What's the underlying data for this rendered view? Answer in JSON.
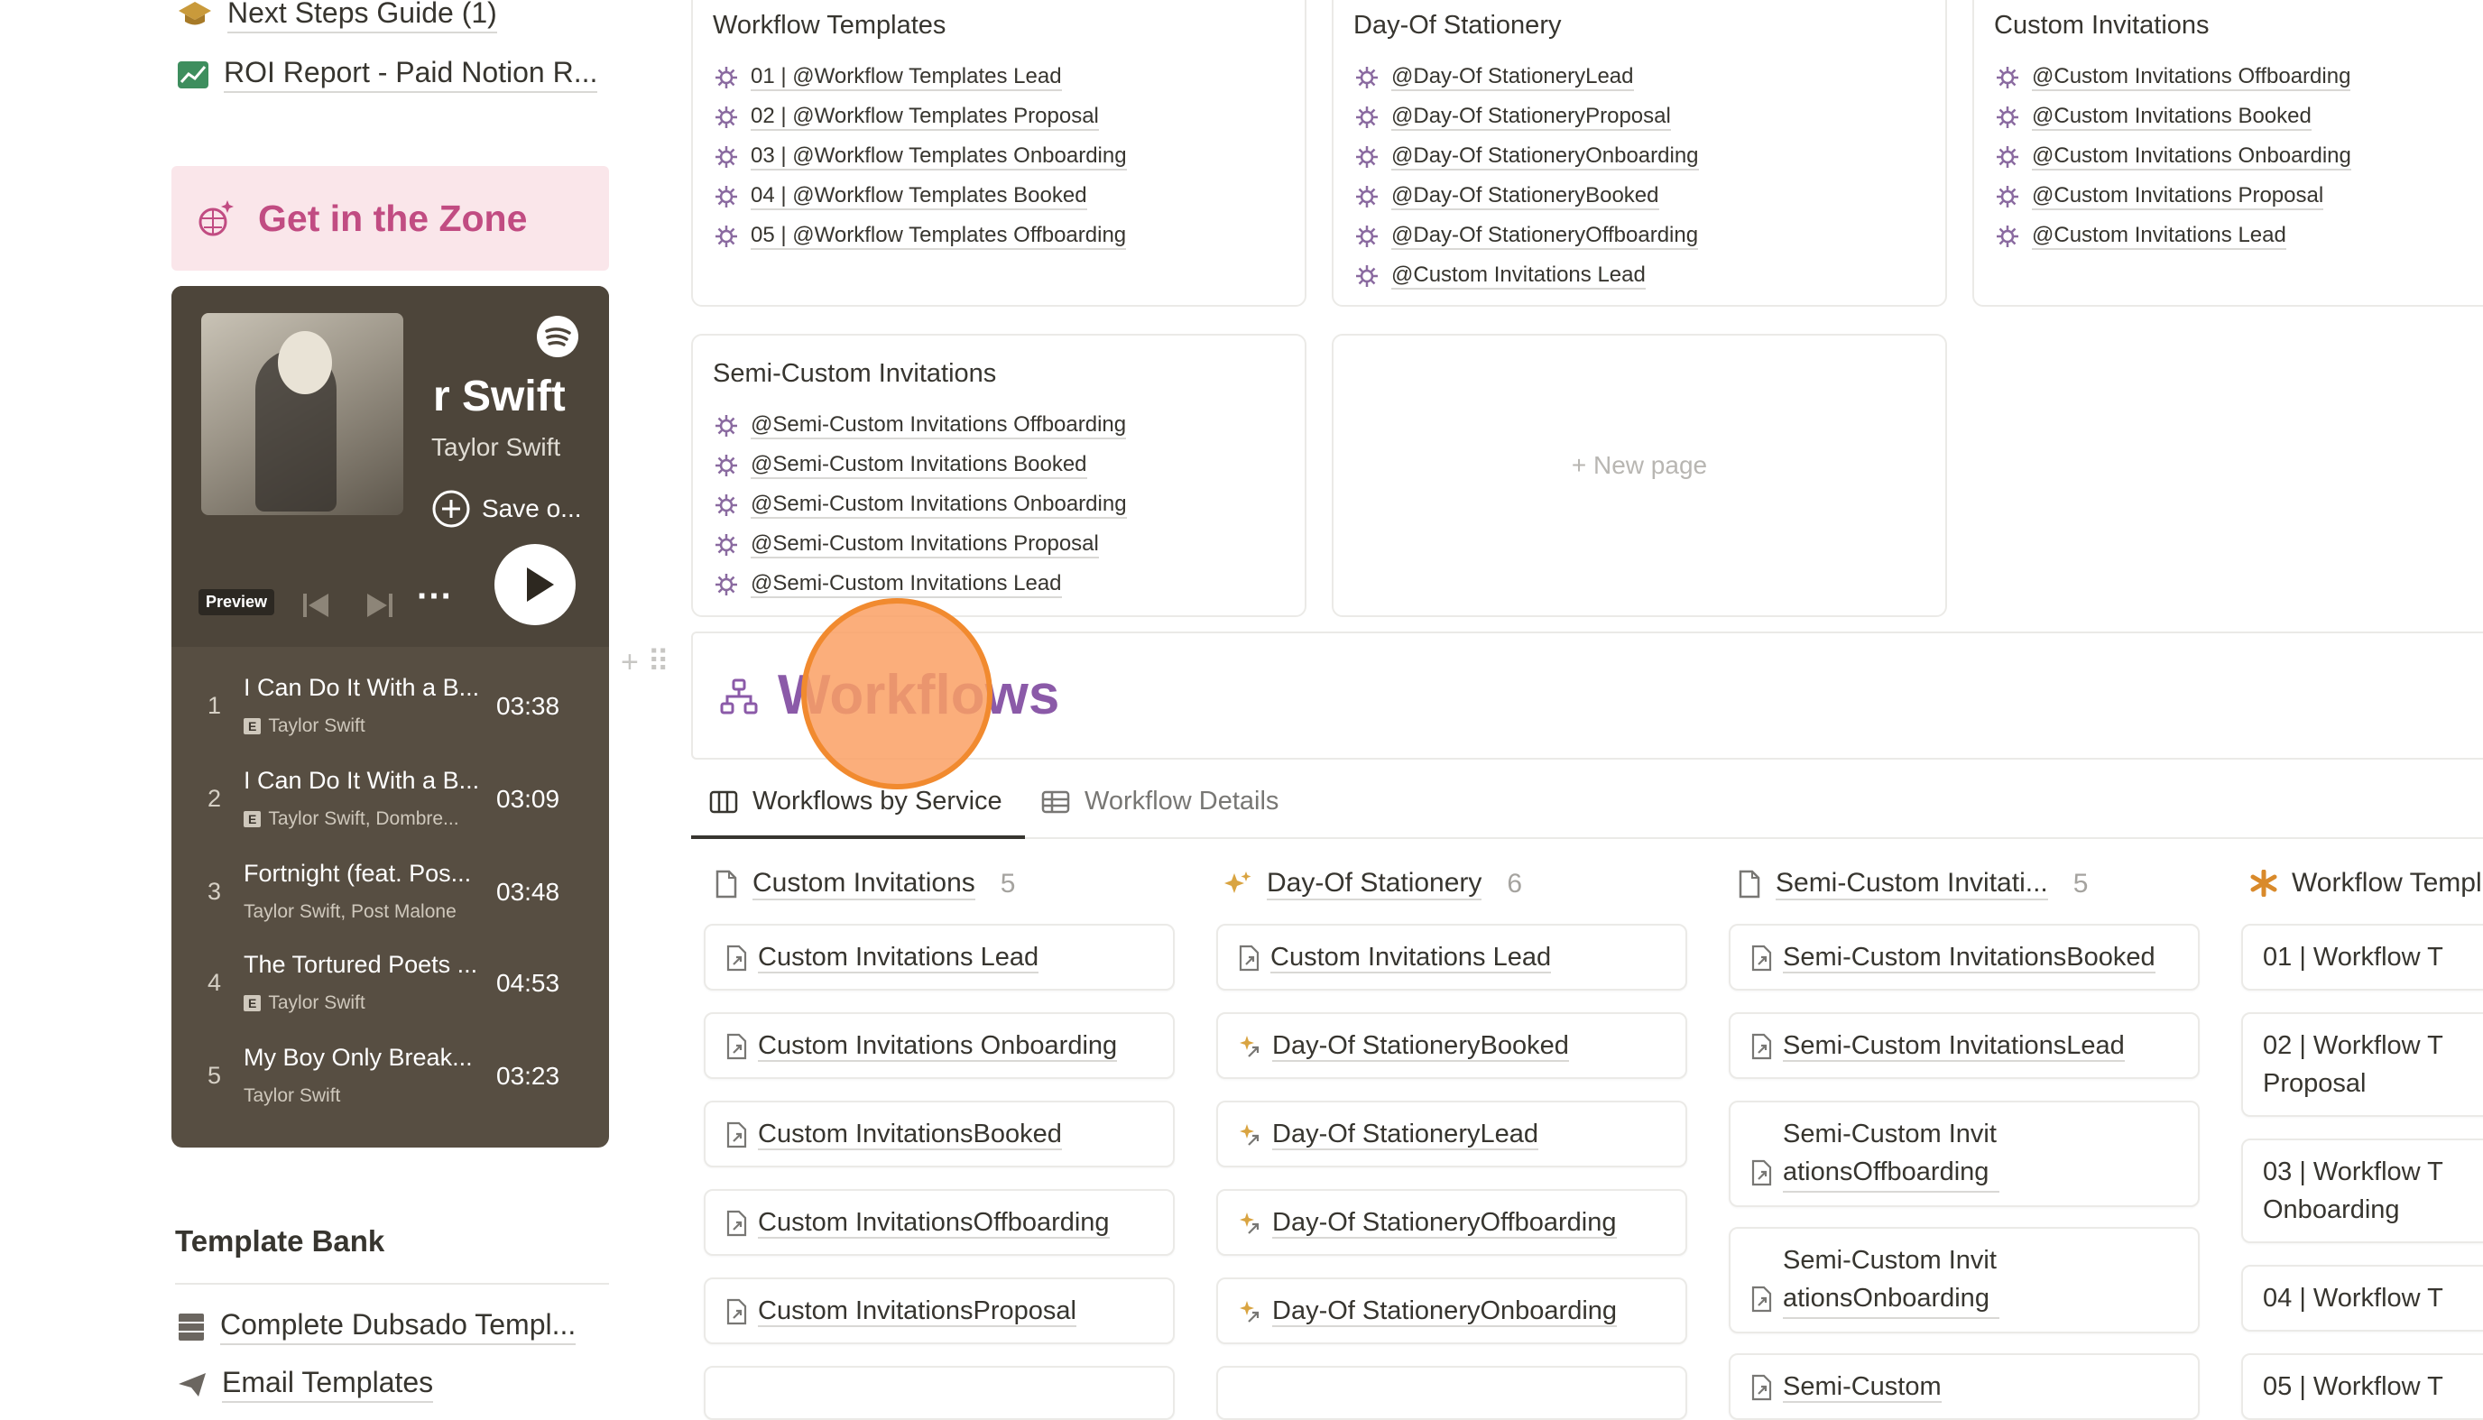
{
  "sidebar": {
    "links": [
      {
        "label": "Next Steps Guide (1)",
        "icon": "graduation-cap-icon"
      },
      {
        "label": "ROI Report - Paid Notion R...",
        "icon": "chart-icon"
      }
    ],
    "zone_title": "Get in the Zone",
    "template_bank": {
      "title": "Template Bank",
      "items": [
        {
          "label": "Complete Dubsado Templ...",
          "icon": "cabinet-icon"
        },
        {
          "label": "Email Templates",
          "icon": "paper-plane-icon"
        }
      ]
    }
  },
  "player": {
    "title": "r Swift",
    "artist": "Taylor Swift",
    "save_label": "Save o...",
    "preview_label": "Preview",
    "more": "···",
    "tracks": [
      {
        "num": "1",
        "name": "I Can Do It With a B...",
        "artist": "Taylor Swift",
        "explicit": "E",
        "duration": "03:38"
      },
      {
        "num": "2",
        "name": "I Can Do It With a B...",
        "artist": "Taylor Swift, Dombre...",
        "explicit": "E",
        "duration": "03:09"
      },
      {
        "num": "3",
        "name": "Fortnight (feat. Pos...",
        "artist": "Taylor Swift, Post Malone",
        "explicit": "",
        "duration": "03:48"
      },
      {
        "num": "4",
        "name": "The Tortured Poets ...",
        "artist": "Taylor Swift",
        "explicit": "E",
        "duration": "04:53"
      },
      {
        "num": "5",
        "name": "My Boy Only Break...",
        "artist": "Taylor Swift",
        "explicit": "",
        "duration": "03:23"
      }
    ]
  },
  "gallery": {
    "cards": [
      {
        "title": "Workflow Templates",
        "items": [
          "01 | @Workflow Templates Lead",
          "02 | @Workflow Templates Proposal",
          "03 | @Workflow Templates Onboarding",
          "04 | @Workflow Templates Booked",
          "05 | @Workflow Templates Offboarding"
        ]
      },
      {
        "title": "Day-Of Stationery",
        "items": [
          "@Day-Of StationeryLead",
          "@Day-Of StationeryProposal",
          "@Day-Of StationeryOnboarding",
          "@Day-Of StationeryBooked",
          "@Day-Of StationeryOffboarding",
          "@Custom Invitations Lead"
        ]
      },
      {
        "title": "Custom Invitations",
        "items": [
          "@Custom Invitations Offboarding",
          "@Custom Invitations Booked",
          "@Custom Invitations Onboarding",
          "@Custom Invitations Proposal",
          "@Custom Invitations Lead"
        ]
      },
      {
        "title": "Semi-Custom Invitations",
        "items": [
          "@Semi-Custom Invitations Offboarding",
          "@Semi-Custom Invitations Booked",
          "@Semi-Custom Invitations Onboarding",
          "@Semi-Custom Invitations Proposal",
          "@Semi-Custom Invitations Lead"
        ]
      }
    ],
    "new_page_label": "New page"
  },
  "workflows": {
    "title": "Workflows",
    "tabs": [
      {
        "label": "Workflows by Service",
        "icon": "board-icon",
        "active": true
      },
      {
        "label": "Workflow Details",
        "icon": "table-icon",
        "active": false
      }
    ]
  },
  "board": {
    "columns": [
      {
        "title": "Custom Invitations",
        "count": "5",
        "icon": "page-icon",
        "cards": [
          "Custom Invitations Lead",
          "Custom Invitations Onboarding",
          "Custom InvitationsBooked",
          "Custom InvitationsOffboarding",
          "Custom InvitationsProposal"
        ]
      },
      {
        "title": "Day-Of Stationery",
        "count": "6",
        "icon": "sparkles-icon",
        "cards": [
          "Custom Invitations Lead",
          "Day-Of StationeryBooked",
          "Day-Of StationeryLead",
          "Day-Of StationeryOffboarding",
          "Day-Of StationeryOnboarding"
        ]
      },
      {
        "title": "Semi-Custom Invitati...",
        "count": "5",
        "icon": "page-icon",
        "cards": [
          "Semi-Custom InvitationsBooked",
          "Semi-Custom InvitationsLead",
          "Semi-Custom InvitationsOffboarding",
          "Semi-Custom InvitationsOnboarding",
          "Semi-Custom"
        ]
      },
      {
        "title": "Workflow Templ",
        "count": "",
        "icon": "asterisk-icon",
        "cards": [
          "01 | Workflow T",
          "02 | Workflow T Proposal",
          "03 | Workflow T Onboarding",
          "04 | Workflow T",
          "05 | Workflow T"
        ]
      }
    ]
  },
  "colors": {
    "accent_purple": "#8b5aa8",
    "zone_pink": "#c14c82",
    "zone_bg": "#fae6ea",
    "player_bg": "#574e42",
    "highlight": "#f18a2f"
  }
}
